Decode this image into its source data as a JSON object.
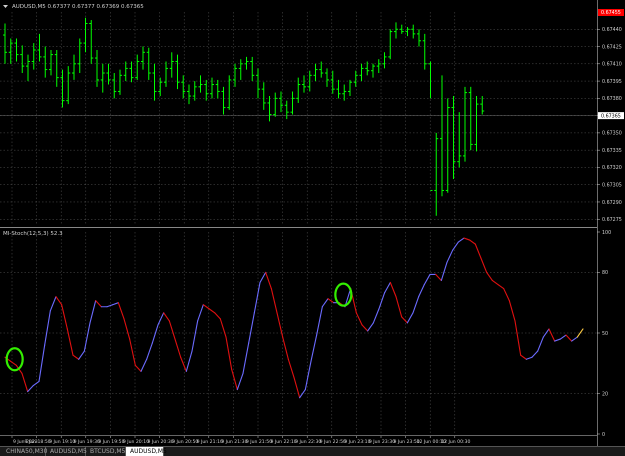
{
  "main_chart": {
    "header": "AUDUSD,M5  0.67377 0.67377 0.67369 0.67365",
    "y_min": 0.6727,
    "y_max": 0.67455,
    "price_ticks": [
      "0.67440",
      "0.67425",
      "0.67410",
      "0.67395",
      "0.67380",
      "0.67365",
      "0.67350",
      "0.67335",
      "0.67320",
      "0.67305",
      "0.67290",
      "0.67275"
    ],
    "current_price": "0.67365",
    "top_tag": "0.67455",
    "bar_color": "#00ff00",
    "bars": [
      [
        0.67435,
        0.67445,
        0.6741,
        0.6742
      ],
      [
        0.6742,
        0.67432,
        0.6741,
        0.67428
      ],
      [
        0.67428,
        0.67432,
        0.67412,
        0.67418
      ],
      [
        0.67418,
        0.67426,
        0.67402,
        0.67408
      ],
      [
        0.67408,
        0.67418,
        0.67395,
        0.67412
      ],
      [
        0.67412,
        0.67428,
        0.67405,
        0.67422
      ],
      [
        0.67422,
        0.67436,
        0.67412,
        0.67416
      ],
      [
        0.67416,
        0.67425,
        0.67398,
        0.67405
      ],
      [
        0.67405,
        0.67422,
        0.674,
        0.67418
      ],
      [
        0.67418,
        0.67422,
        0.6739,
        0.67398
      ],
      [
        0.67398,
        0.67405,
        0.67372,
        0.67378
      ],
      [
        0.67378,
        0.67408,
        0.67375,
        0.67402
      ],
      [
        0.67402,
        0.67418,
        0.67396,
        0.6741
      ],
      [
        0.6741,
        0.67432,
        0.67402,
        0.67428
      ],
      [
        0.67428,
        0.6745,
        0.6742,
        0.67445
      ],
      [
        0.67445,
        0.67448,
        0.6741,
        0.67415
      ],
      [
        0.67415,
        0.67422,
        0.6739,
        0.67396
      ],
      [
        0.67396,
        0.6741,
        0.67385,
        0.67402
      ],
      [
        0.67402,
        0.6741,
        0.67392,
        0.67396
      ],
      [
        0.67396,
        0.67402,
        0.6738,
        0.67386
      ],
      [
        0.67386,
        0.67405,
        0.67383,
        0.674
      ],
      [
        0.674,
        0.67412,
        0.67395,
        0.67406
      ],
      [
        0.67406,
        0.67412,
        0.67394,
        0.67398
      ],
      [
        0.67398,
        0.67418,
        0.67396,
        0.67412
      ],
      [
        0.67412,
        0.67425,
        0.67405,
        0.6742
      ],
      [
        0.6742,
        0.67424,
        0.67396,
        0.67402
      ],
      [
        0.67402,
        0.6741,
        0.67378,
        0.67386
      ],
      [
        0.67386,
        0.67398,
        0.67382,
        0.67394
      ],
      [
        0.67394,
        0.67412,
        0.6739,
        0.67406
      ],
      [
        0.67406,
        0.6742,
        0.67398,
        0.67412
      ],
      [
        0.67412,
        0.67418,
        0.67388,
        0.67394
      ],
      [
        0.67394,
        0.674,
        0.6738,
        0.67386
      ],
      [
        0.67386,
        0.67392,
        0.67375,
        0.67382
      ],
      [
        0.67382,
        0.67395,
        0.67378,
        0.6739
      ],
      [
        0.6739,
        0.674,
        0.67385,
        0.67392
      ],
      [
        0.67392,
        0.67396,
        0.67378,
        0.67384
      ],
      [
        0.67384,
        0.67398,
        0.6738,
        0.67392
      ],
      [
        0.67392,
        0.67396,
        0.6738,
        0.67386
      ],
      [
        0.67386,
        0.6739,
        0.67366,
        0.67372
      ],
      [
        0.67372,
        0.674,
        0.6737,
        0.67396
      ],
      [
        0.67396,
        0.6741,
        0.6739,
        0.67406
      ],
      [
        0.67406,
        0.67414,
        0.67396,
        0.6741
      ],
      [
        0.6741,
        0.67416,
        0.67405,
        0.67412
      ],
      [
        0.67412,
        0.67416,
        0.67395,
        0.674
      ],
      [
        0.674,
        0.67406,
        0.6738,
        0.67388
      ],
      [
        0.67388,
        0.67394,
        0.6737,
        0.67376
      ],
      [
        0.67376,
        0.67382,
        0.6736,
        0.67366
      ],
      [
        0.67366,
        0.67385,
        0.67364,
        0.6738
      ],
      [
        0.6738,
        0.67386,
        0.67368,
        0.67374
      ],
      [
        0.67374,
        0.67378,
        0.67362,
        0.67368
      ],
      [
        0.67368,
        0.67386,
        0.67366,
        0.6738
      ],
      [
        0.6738,
        0.67398,
        0.67376,
        0.67392
      ],
      [
        0.67392,
        0.674,
        0.67385,
        0.6739
      ],
      [
        0.6739,
        0.67404,
        0.67386,
        0.674
      ],
      [
        0.674,
        0.6741,
        0.67395,
        0.67405
      ],
      [
        0.67405,
        0.67412,
        0.67398,
        0.67402
      ],
      [
        0.67402,
        0.67406,
        0.6739,
        0.67396
      ],
      [
        0.67396,
        0.67404,
        0.67384,
        0.67388
      ],
      [
        0.67388,
        0.67396,
        0.6738,
        0.67384
      ],
      [
        0.67384,
        0.67392,
        0.67378,
        0.67386
      ],
      [
        0.67386,
        0.67396,
        0.67382,
        0.67394
      ],
      [
        0.67394,
        0.67404,
        0.6739,
        0.674
      ],
      [
        0.674,
        0.6741,
        0.67395,
        0.67406
      ],
      [
        0.67406,
        0.67412,
        0.674,
        0.67404
      ],
      [
        0.67404,
        0.6741,
        0.67398,
        0.67408
      ],
      [
        0.67408,
        0.67414,
        0.67402,
        0.6741
      ],
      [
        0.6741,
        0.6742,
        0.67406,
        0.67416
      ],
      [
        0.67416,
        0.6744,
        0.67414,
        0.67438
      ],
      [
        0.67438,
        0.67446,
        0.67432,
        0.6744
      ],
      [
        0.6744,
        0.67444,
        0.67436,
        0.67438
      ],
      [
        0.67438,
        0.67442,
        0.67434,
        0.6744
      ],
      [
        0.6744,
        0.67444,
        0.67432,
        0.67436
      ],
      [
        0.67436,
        0.6744,
        0.67425,
        0.6743
      ],
      [
        0.6743,
        0.67436,
        0.67405,
        0.6741
      ],
      [
        0.6741,
        0.67412,
        0.6738,
        0.673
      ],
      [
        0.673,
        0.6735,
        0.67278,
        0.67345
      ],
      [
        0.67345,
        0.674,
        0.67295,
        0.673
      ],
      [
        0.673,
        0.6738,
        0.67298,
        0.67372
      ],
      [
        0.67372,
        0.67382,
        0.6731,
        0.67325
      ],
      [
        0.67325,
        0.67368,
        0.6732,
        0.6733
      ],
      [
        0.6733,
        0.6739,
        0.67325,
        0.67385
      ],
      [
        0.67385,
        0.6739,
        0.67335,
        0.6734
      ],
      [
        0.6734,
        0.67382,
        0.67334,
        0.67375
      ],
      [
        0.67375,
        0.67382,
        0.67366,
        0.67369
      ]
    ]
  },
  "indicator": {
    "header": "MI-Stoch(12,5,3)  52.3",
    "y_ticks": [
      100,
      80,
      50,
      20,
      0
    ],
    "levels": [
      80,
      50,
      20
    ],
    "up_color": "#6b6bff",
    "down_color": "#e01010",
    "last_color": "#ffcc44",
    "values": [
      38,
      36,
      34,
      30,
      21,
      24,
      26,
      44,
      61,
      68,
      64,
      52,
      39,
      37,
      41,
      55,
      66,
      63,
      63,
      64,
      65,
      57,
      47,
      34,
      31,
      37,
      45,
      54,
      60,
      56,
      47,
      38,
      31,
      41,
      56,
      64,
      62,
      60,
      57,
      48,
      32,
      22,
      30,
      45,
      60,
      75,
      80,
      72,
      60,
      48,
      37,
      28,
      18,
      22,
      36,
      49,
      63,
      67,
      65,
      65,
      63,
      72,
      60,
      54,
      51,
      55,
      62,
      70,
      75,
      68,
      58,
      55,
      60,
      68,
      74,
      79,
      79,
      76,
      85,
      91,
      95,
      97,
      96,
      94,
      87,
      80,
      76,
      74,
      72,
      66,
      56,
      39,
      37,
      38,
      41,
      48,
      52,
      46,
      47,
      49,
      46,
      48,
      52
    ],
    "circles": [
      {
        "i": 1,
        "v": 37
      },
      {
        "i": 59,
        "v": 69
      }
    ],
    "circle_color": "#33ee00"
  },
  "time_labels": [
    "9 Jun 2023",
    "9 Jun 18:50",
    "9 Jun 19:10",
    "9 Jun 19:30",
    "9 Jun 19:50",
    "9 Jun 20:10",
    "9 Jun 20:30",
    "9 Jun 20:50",
    "9 Jun 21:10",
    "9 Jun 21:30",
    "9 Jun 21:50",
    "9 Jun 22:10",
    "9 Jun 22:30",
    "9 Jun 22:50",
    "9 Jun 23:10",
    "9 Jun 23:30",
    "9 Jun 23:50",
    "12 Jun 00:10",
    "12 Jun 00:30"
  ],
  "tabs": [
    {
      "label": "CHINA50,M30",
      "active": false
    },
    {
      "label": "AUDUSD,M5",
      "active": false
    },
    {
      "label": "BTCUSD,M5",
      "active": false
    },
    {
      "label": "AUDUSD,M5",
      "active": true
    }
  ],
  "colors": {
    "grid": "#555555",
    "text": "#d0d0d0",
    "price_tag_bg": "#ffffff",
    "top_tag_bg": "#ff0000"
  }
}
